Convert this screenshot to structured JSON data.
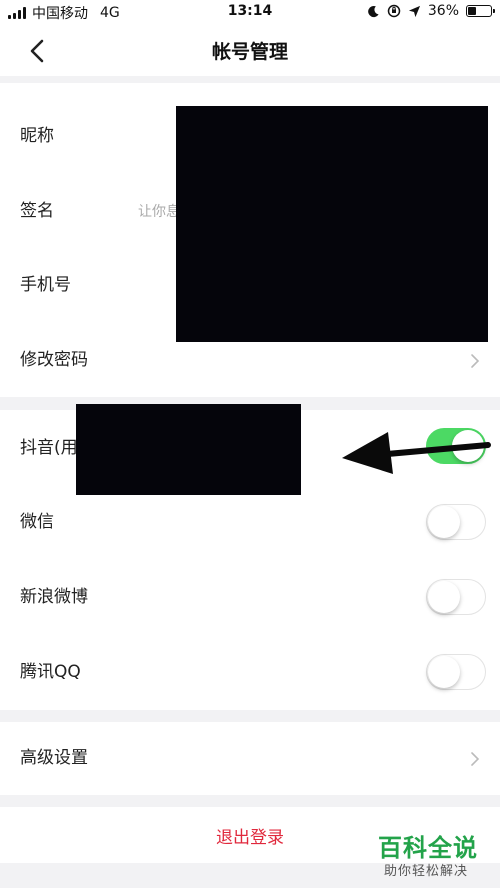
{
  "status_bar": {
    "carrier": "中国移动",
    "network": "4G",
    "time": "13:14",
    "battery_percent": "36%",
    "battery_level": 0.36
  },
  "nav": {
    "title": "帐号管理",
    "back_icon": "chevron-left-icon"
  },
  "profile_section": {
    "nickname_label": "昵称",
    "signature_label": "签名",
    "signature_value": "让你息",
    "phone_label": "手机号",
    "password_label": "修改密码"
  },
  "bindings_section": {
    "items": [
      {
        "label": "抖音(用",
        "enabled": true
      },
      {
        "label": "微信",
        "enabled": false
      },
      {
        "label": "新浪微博",
        "enabled": false
      },
      {
        "label": "腾讯QQ",
        "enabled": false
      }
    ]
  },
  "advanced": {
    "label": "高级设置"
  },
  "logout": {
    "label": "退出登录"
  },
  "watermark": {
    "title": "百科全说",
    "subtitle": "助你轻松解决"
  },
  "colors": {
    "toggle_on": "#4cd964",
    "logout_text": "#e0283c",
    "watermark_green": "#23a34a",
    "background": "#f2f2f4"
  }
}
